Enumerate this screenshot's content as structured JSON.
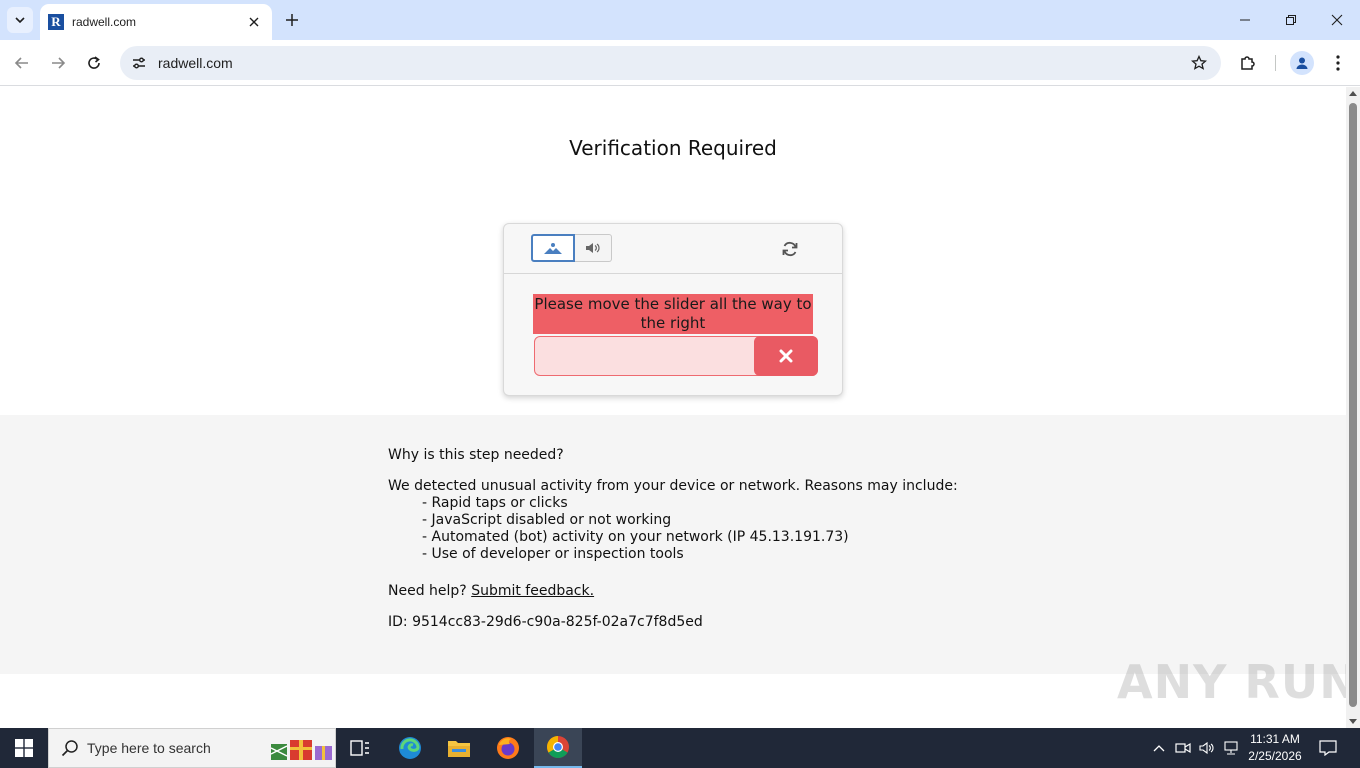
{
  "browser": {
    "tab_title": "radwell.com",
    "favicon_letter": "R",
    "url": "radwell.com"
  },
  "page": {
    "title": "Verification Required",
    "captcha": {
      "message": "Please move the slider all the way to the right",
      "slider_progress": 0
    },
    "info": {
      "heading": "Why is this step needed?",
      "intro": "We detected unusual activity from your device or network. Reasons may include:",
      "reasons": [
        "- Rapid taps or clicks",
        "- JavaScript disabled or not working",
        "- Automated (bot) activity on your network (IP 45.13.191.73)",
        "- Use of developer or inspection tools"
      ],
      "help_prefix": "Need help?",
      "help_link": "Submit feedback.",
      "id_line": "ID: 9514cc83-29d6-c90a-825f-02a7c7f8d5ed"
    }
  },
  "watermark": "ANY RUN",
  "taskbar": {
    "search_placeholder": "Type here to search",
    "time": "11:31 AM",
    "date": "2/25/2026"
  }
}
